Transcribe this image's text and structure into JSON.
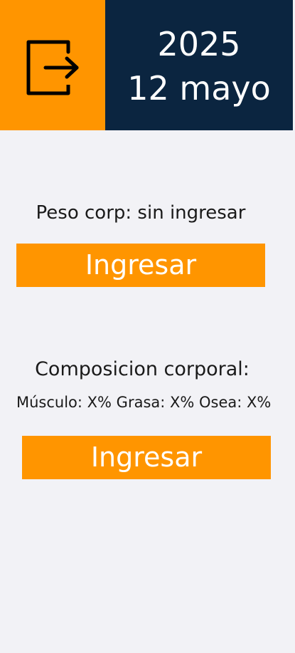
{
  "header": {
    "logout_icon": "logout-icon",
    "year": "2025",
    "date": "12 mayo"
  },
  "weight": {
    "label": "Peso corp: sin ingresar",
    "button_label": "Ingresar"
  },
  "composition": {
    "label": "Composicion corporal:",
    "values": "Músculo: X% Grasa: X% Osea: X%",
    "button_label": "Ingresar"
  },
  "colors": {
    "accent": "#ff9500",
    "header_dark": "#0b2540",
    "background": "#f2f2f6"
  }
}
